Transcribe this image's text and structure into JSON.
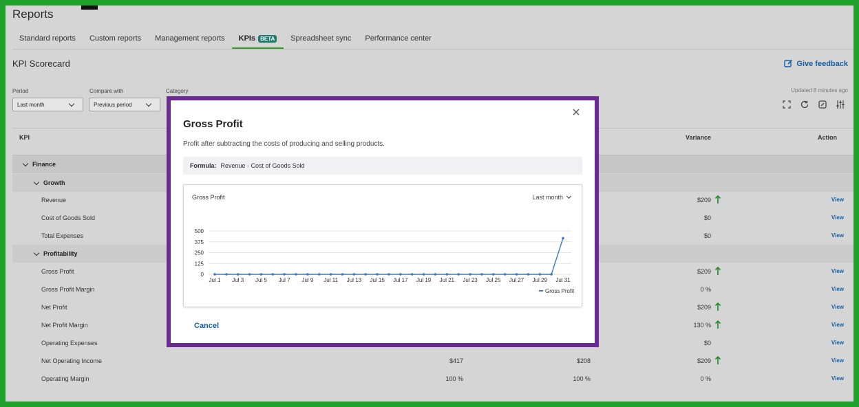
{
  "page": {
    "title": "Reports"
  },
  "tabs": [
    {
      "label": "Standard reports"
    },
    {
      "label": "Custom reports"
    },
    {
      "label": "Management reports"
    },
    {
      "label": "KPIs",
      "badge": "BETA",
      "active": true
    },
    {
      "label": "Spreadsheet sync"
    },
    {
      "label": "Performance center"
    }
  ],
  "scorecard": {
    "title": "KPI Scorecard",
    "feedback_label": "Give feedback",
    "updated_text": "Updated 8 minutes ago",
    "filters": {
      "period_label": "Period",
      "period_value": "Last month",
      "compare_label": "Compare with",
      "compare_value": "Previous period",
      "category_label": "Category"
    },
    "columns": {
      "kpi": "KPI",
      "variance": "Variance",
      "action": "Action"
    },
    "groups": {
      "finance": "Finance",
      "growth": "Growth",
      "profitability": "Profitability"
    },
    "rows": [
      {
        "name": "Revenue",
        "c1": "",
        "c2": "",
        "variance": "$209",
        "up": true,
        "view": "View"
      },
      {
        "name": "Cost of Goods Sold",
        "c1": "",
        "c2": "",
        "variance": "$0",
        "up": false,
        "view": "View"
      },
      {
        "name": "Total Expenses",
        "c1": "",
        "c2": "",
        "variance": "$0",
        "up": false,
        "view": "View"
      },
      {
        "name": "Gross Profit",
        "c1": "",
        "c2": "",
        "variance": "$209",
        "up": true,
        "view": "View"
      },
      {
        "name": "Gross Profit Margin",
        "c1": "",
        "c2": "",
        "variance": "0 %",
        "up": false,
        "view": "View"
      },
      {
        "name": "Net Profit",
        "c1": "",
        "c2": "",
        "variance": "$209",
        "up": true,
        "view": "View"
      },
      {
        "name": "Net Profit Margin",
        "c1": "",
        "c2": "",
        "variance": "130 %",
        "up": true,
        "view": "View"
      },
      {
        "name": "Operating Expenses",
        "c1": "",
        "c2": "",
        "variance": "$0",
        "up": false,
        "view": "View"
      },
      {
        "name": "Net Operating Income",
        "c1": "$417",
        "c2": "$208",
        "variance": "$209",
        "up": true,
        "view": "View"
      },
      {
        "name": "Operating Margin",
        "c1": "100 %",
        "c2": "100 %",
        "variance": "0 %",
        "up": false,
        "view": "View"
      }
    ]
  },
  "modal": {
    "title": "Gross Profit",
    "description": "Profit after subtracting the costs of producing and selling products.",
    "formula_label": "Formula:",
    "formula_value": "Revenue - Cost of Goods Sold",
    "cancel_label": "Cancel"
  },
  "colors": {
    "accent_green": "#2ca01c",
    "link_blue": "#135ea3",
    "modal_border": "#6a2a91",
    "line_blue": "#3a78c4",
    "up_arrow": "#1e8a2a"
  },
  "chart_data": {
    "type": "line",
    "title": "Gross Profit",
    "period": "Last month",
    "x": [
      "Jul 1",
      "Jul 2",
      "Jul 3",
      "Jul 4",
      "Jul 5",
      "Jul 6",
      "Jul 7",
      "Jul 8",
      "Jul 9",
      "Jul 10",
      "Jul 11",
      "Jul 12",
      "Jul 13",
      "Jul 14",
      "Jul 15",
      "Jul 16",
      "Jul 17",
      "Jul 18",
      "Jul 19",
      "Jul 20",
      "Jul 21",
      "Jul 22",
      "Jul 23",
      "Jul 24",
      "Jul 25",
      "Jul 26",
      "Jul 27",
      "Jul 28",
      "Jul 29",
      "Jul 30",
      "Jul 31"
    ],
    "xtick_labels": [
      "Jul 1",
      "Jul 3",
      "Jul 5",
      "Jul 7",
      "Jul 9",
      "Jul 11",
      "Jul 13",
      "Jul 15",
      "Jul 17",
      "Jul 19",
      "Jul 21",
      "Jul 23",
      "Jul 25",
      "Jul 27",
      "Jul 29",
      "Jul 31"
    ],
    "series": [
      {
        "name": "Gross Profit",
        "values": [
          0,
          0,
          0,
          0,
          0,
          0,
          0,
          0,
          0,
          0,
          0,
          0,
          0,
          0,
          0,
          0,
          0,
          0,
          0,
          0,
          0,
          0,
          0,
          0,
          0,
          0,
          0,
          0,
          0,
          0,
          417
        ]
      }
    ],
    "yticks": [
      0,
      125,
      250,
      375,
      500
    ],
    "ylim": [
      0,
      500
    ],
    "grid": true,
    "legend": "bottom-right"
  }
}
